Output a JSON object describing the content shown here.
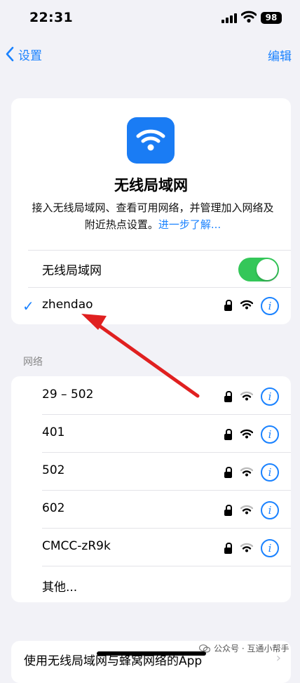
{
  "status_bar": {
    "time": "22:31",
    "battery": "98"
  },
  "nav": {
    "back_label": "设置",
    "edit_label": "编辑"
  },
  "wifi_card": {
    "title": "无线局域网",
    "description": "接入无线局域网、查看可用网络，并管理加入网络及附近热点设置。",
    "learn_more": "进一步了解...",
    "toggle_label": "无线局域网",
    "toggle_on": true,
    "connected_network": "zhendao"
  },
  "networks_section_label": "网络",
  "networks": [
    {
      "name": "29 – 502",
      "locked": true
    },
    {
      "name": "401",
      "locked": true
    },
    {
      "name": "502",
      "locked": true
    },
    {
      "name": "602",
      "locked": true
    },
    {
      "name": "CMCC-zR9k",
      "locked": true
    }
  ],
  "other_label": "其他...",
  "bottom_row_label": "使用无线局域网与蜂窝网络的App",
  "watermark": "公众号 · 互通小帮手",
  "colors": {
    "accent": "#1a82ff",
    "toggle": "#34c759",
    "arrow": "#e02020"
  }
}
